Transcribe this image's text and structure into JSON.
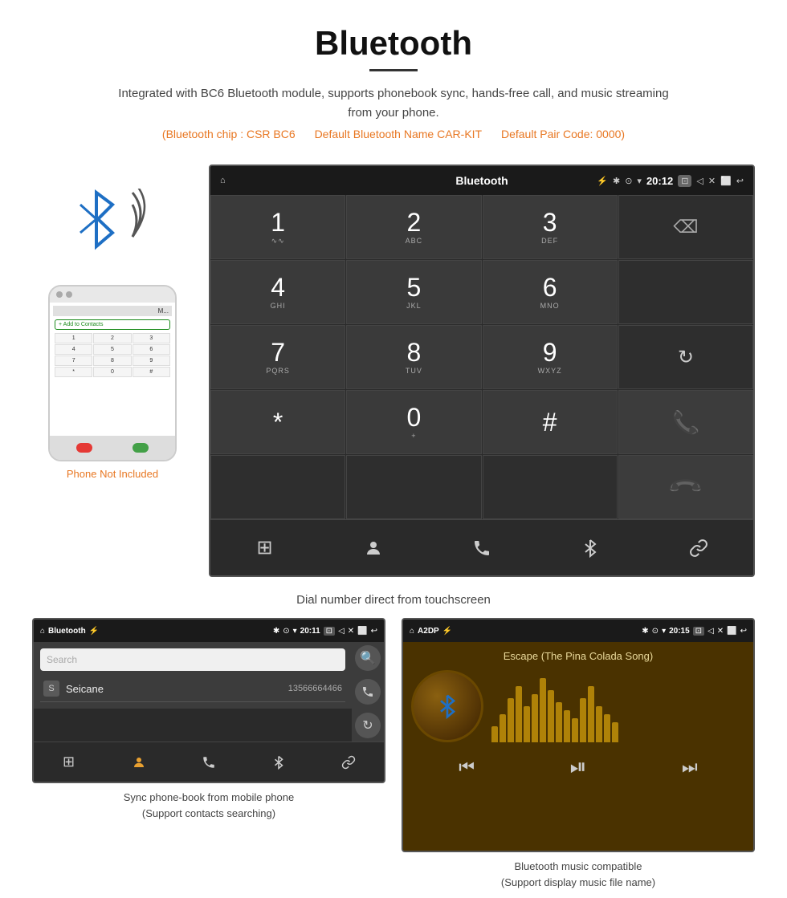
{
  "page": {
    "title": "Bluetooth",
    "divider": true,
    "description": "Integrated with BC6 Bluetooth module, supports phonebook sync, hands-free call, and music streaming from your phone.",
    "specs": {
      "chip": "(Bluetooth chip : CSR BC6",
      "name": "Default Bluetooth Name CAR-KIT",
      "code": "Default Pair Code: 0000)"
    }
  },
  "dialScreen": {
    "statusBar": {
      "homeIcon": "⌂",
      "title": "Bluetooth",
      "usbIcon": "⚡",
      "bluetoothIcon": "✱",
      "locationIcon": "⊙",
      "signalIcon": "▾",
      "time": "20:12",
      "cameraIcon": "⊡",
      "volumeIcon": "◁",
      "closeIcon": "✕",
      "windowIcon": "⬜",
      "backIcon": "↩"
    },
    "keys": [
      {
        "number": "1",
        "letters": "∿∿",
        "col": 1
      },
      {
        "number": "2",
        "letters": "ABC",
        "col": 2
      },
      {
        "number": "3",
        "letters": "DEF",
        "col": 3
      },
      {
        "number": "4",
        "letters": "GHI",
        "col": 1
      },
      {
        "number": "5",
        "letters": "JKL",
        "col": 2
      },
      {
        "number": "6",
        "letters": "MNO",
        "col": 3
      },
      {
        "number": "7",
        "letters": "PQRS",
        "col": 1
      },
      {
        "number": "8",
        "letters": "TUV",
        "col": 2
      },
      {
        "number": "9",
        "letters": "WXYZ",
        "col": 3
      },
      {
        "number": "*",
        "letters": "",
        "col": 1
      },
      {
        "number": "0",
        "letters": "+",
        "col": 2
      },
      {
        "number": "#",
        "letters": "",
        "col": 3
      }
    ],
    "deleteIcon": "⌫",
    "reloadIcon": "↻",
    "callIcon": "📞",
    "endCallIcon": "📞",
    "caption": "Dial number direct from touchscreen"
  },
  "phonebookScreen": {
    "statusBar": {
      "homeIcon": "⌂",
      "title": "Bluetooth",
      "time": "20:11"
    },
    "searchPlaceholder": "Search",
    "contacts": [
      {
        "letter": "S",
        "name": "Seicane",
        "number": "13566664466"
      }
    ],
    "bottomNav": [
      "⊞",
      "👤",
      "📞",
      "✱",
      "🔗"
    ],
    "caption": "Sync phone-book from mobile phone\n(Support contacts searching)"
  },
  "musicScreen": {
    "statusBar": {
      "homeIcon": "⌂",
      "title": "A2DP",
      "time": "20:15"
    },
    "songTitle": "Escape (The Pina Colada Song)",
    "bluetoothIcon": "✱",
    "visualizerBars": [
      20,
      35,
      55,
      70,
      45,
      60,
      80,
      65,
      50,
      40,
      30,
      55,
      70,
      45,
      35,
      25
    ],
    "controls": {
      "prev": "⏮",
      "playPause": "⏯",
      "next": "⏭"
    },
    "caption": "Bluetooth music compatible\n(Support display music file name)"
  },
  "phoneSide": {
    "notIncluded": "Phone Not Included"
  }
}
